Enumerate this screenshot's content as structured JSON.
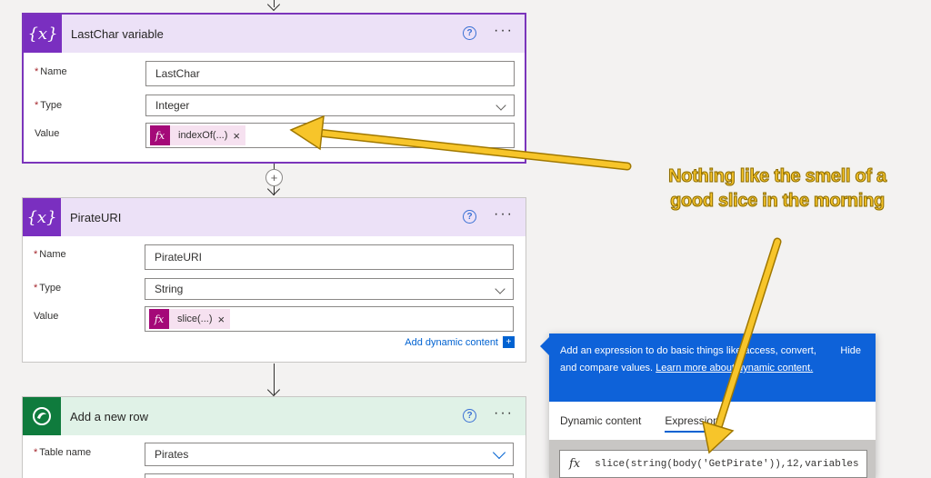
{
  "cards": [
    {
      "title": "LastChar variable",
      "fields": {
        "name_label": "Name",
        "name_value": "LastChar",
        "type_label": "Type",
        "type_value": "Integer",
        "value_label": "Value",
        "value_token": "indexOf(...)"
      }
    },
    {
      "title": "PirateURI",
      "fields": {
        "name_label": "Name",
        "name_value": "PirateURI",
        "type_label": "Type",
        "type_value": "String",
        "value_label": "Value",
        "value_token": "slice(...)"
      },
      "add_dynamic": "Add dynamic content"
    },
    {
      "title": "Add a new row",
      "fields": {
        "table_label": "Table name",
        "table_value": "Pirates"
      }
    }
  ],
  "common": {
    "help_symbol": "?",
    "more_symbol": "···",
    "required_mark": "*",
    "remove_symbol": "×",
    "variable_icon": "{x}",
    "fx_icon": "fx"
  },
  "panel": {
    "description": "Add an expression to do basic things like access, convert, and compare values.",
    "learn_more": "Learn more about dynamic content.",
    "hide": "Hide",
    "tabs": [
      "Dynamic content",
      "Expression"
    ],
    "expression": "slice(string(body('GetPirate')),12,variables"
  },
  "callout": {
    "line1": "Nothing like the smell of a",
    "line2": "good slice in the morning"
  },
  "colors": {
    "variable_accent": "#7a2fc0",
    "dataverse_accent": "#0f7b3d",
    "token_fx": "#a40978",
    "link_blue": "#0062d1",
    "callout_yellow": "#f7c52a"
  }
}
